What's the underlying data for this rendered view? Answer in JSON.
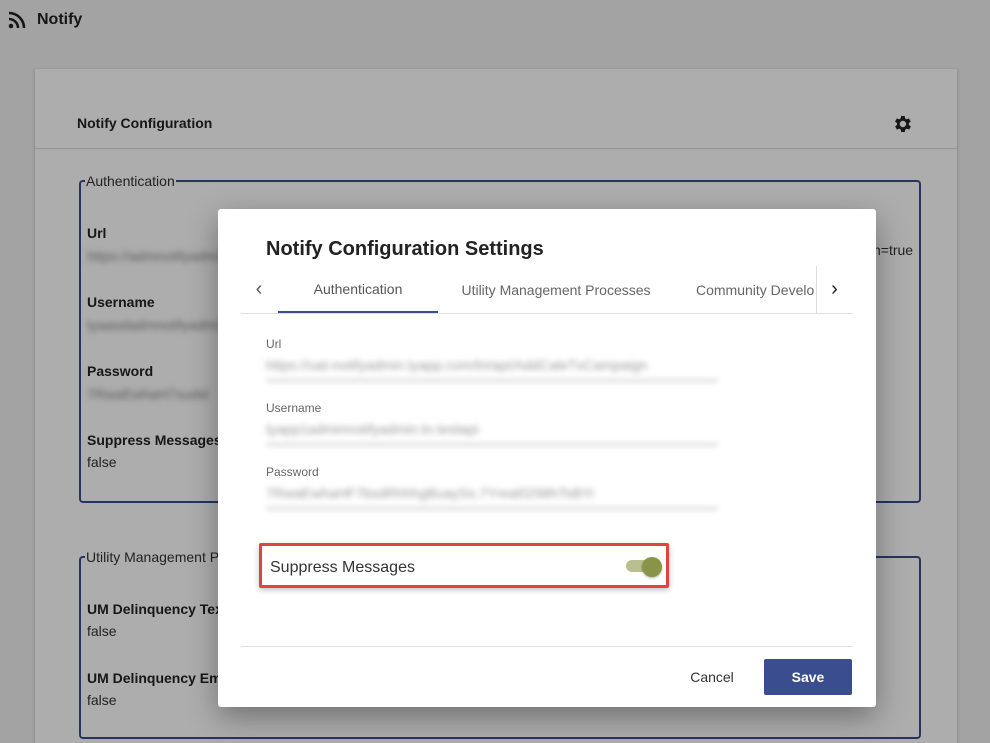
{
  "app": {
    "title": "Notify",
    "icon": "rss-icon"
  },
  "card": {
    "title": "Notify Configuration",
    "settings_icon": "gear-icon"
  },
  "bg_auth": {
    "legend": "Authentication",
    "url_label": "Url",
    "url_value": "https://admnotifyadmi",
    "url_suffix_fragment": "n=true",
    "username_label": "Username",
    "username_value": "tyaasdadmnotifyadmi",
    "password_label": "Password",
    "password_value": "7RwaEwhaH7sudsl",
    "suppress_label": "Suppress Messages",
    "suppress_value": "false"
  },
  "bg_um": {
    "legend": "Utility Management P",
    "delinq_text_label": "UM Delinquency Text",
    "delinq_text_value": "false",
    "delinq_email_label": "UM Delinquency Ema",
    "delinq_email_value": "false"
  },
  "modal": {
    "title": "Notify Configuration Settings",
    "tabs": [
      {
        "label": "Authentication",
        "active": true
      },
      {
        "label": "Utility Management Processes",
        "active": false
      },
      {
        "label": "Community Develo",
        "active": false
      }
    ],
    "left_arrow": "‹",
    "right_arrow": "›",
    "fields": {
      "url": {
        "label": "Url",
        "value": "https://uat-notifyadmin.tyapp.com/tn/api/AddCaleTxCampaign"
      },
      "username": {
        "label": "Username",
        "value": "tyapp1adminnotifyadmin.tn.testapi"
      },
      "password": {
        "label": "Password",
        "value": "7RwaEwhaHF7bsdRhhhgBuaySs.7Yreal0298hTsBYi"
      }
    },
    "suppress_label": "Suppress Messages",
    "suppress_enabled": true,
    "cancel_label": "Cancel",
    "save_label": "Save"
  },
  "colors": {
    "accent": "#3a4d8f",
    "highlight": "#e0443e",
    "toggle": "#8a9447"
  }
}
